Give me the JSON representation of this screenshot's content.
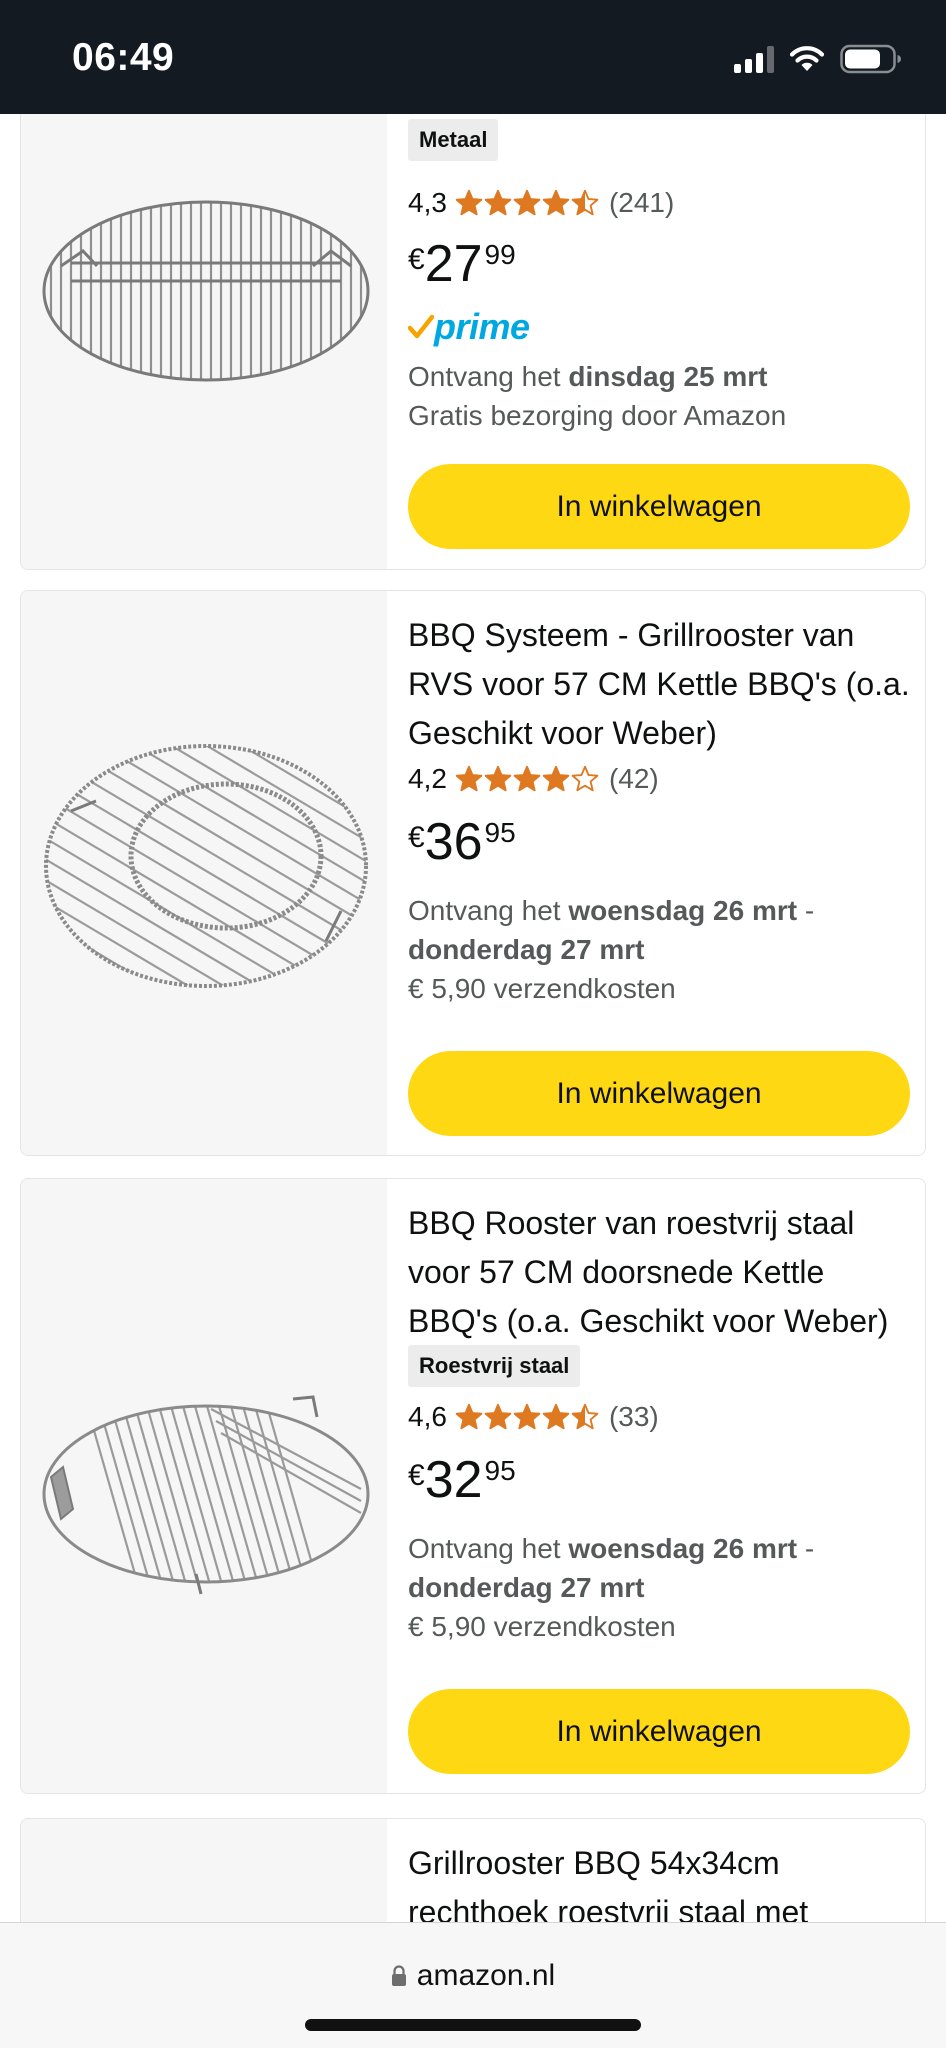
{
  "status_bar": {
    "time": "06:49"
  },
  "products": [
    {
      "badge": "Metaal",
      "rating": "4,3",
      "stars": 4.3,
      "review_count": "(241)",
      "price": {
        "currency": "€",
        "whole": "27",
        "fraction": "99"
      },
      "prime": "prime",
      "delivery_prefix": "Ontvang het ",
      "delivery_date": "dinsdag 25 mrt",
      "delivery_note": "Gratis bezorging door Amazon",
      "cart_label": "In winkelwagen"
    },
    {
      "title": "BBQ Systeem - Grillrooster van RVS voor 57 CM Kettle BBQ's (o.a. Geschikt voor Weber)",
      "rating": "4,2",
      "stars": 4.2,
      "review_count": "(42)",
      "price": {
        "currency": "€",
        "whole": "36",
        "fraction": "95"
      },
      "delivery_prefix": "Ontvang het ",
      "delivery_date": "woensdag 26 mrt",
      "delivery_sep": " - ",
      "delivery_date2": "donderdag 27 mrt",
      "delivery_note": "€ 5,90 verzendkosten",
      "cart_label": "In winkelwagen"
    },
    {
      "title": "BBQ Rooster van roestvrij staal voor 57 CM doorsnede Kettle BBQ's (o.a. Geschikt voor Weber)",
      "badge": "Roestvrij staal",
      "rating": "4,6",
      "stars": 4.6,
      "review_count": "(33)",
      "price": {
        "currency": "€",
        "whole": "32",
        "fraction": "95"
      },
      "delivery_prefix": "Ontvang het ",
      "delivery_date": "woensdag 26 mrt",
      "delivery_sep": " - ",
      "delivery_date2": "donderdag 27 mrt",
      "delivery_note": "€ 5,90 verzendkosten",
      "cart_label": "In winkelwagen"
    },
    {
      "title": "Grillrooster BBQ 54x34cm rechthoek roestvrij staal met"
    }
  ],
  "browser": {
    "url": "amazon.nl"
  },
  "colors": {
    "star": "#de7921",
    "cart_button": "#ffd814",
    "prime_blue": "#00a8e1",
    "prime_check": "#f7a300"
  }
}
